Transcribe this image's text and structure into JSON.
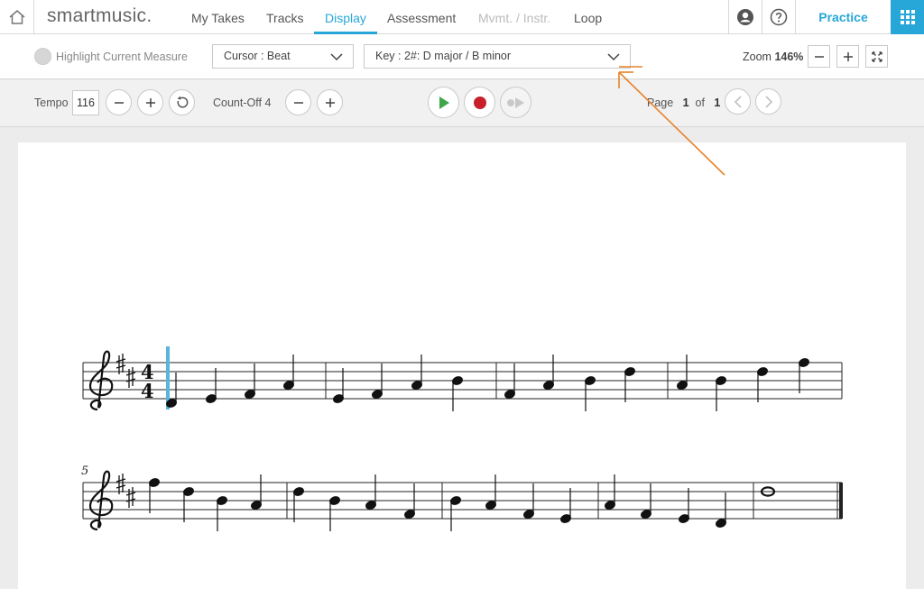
{
  "app": {
    "logo": "smartmusic.",
    "nav": [
      {
        "label": "My Takes",
        "state": "normal"
      },
      {
        "label": "Tracks",
        "state": "normal"
      },
      {
        "label": "Display",
        "state": "active"
      },
      {
        "label": "Assessment",
        "state": "normal"
      },
      {
        "label": "Mvmt. / Instr.",
        "state": "disabled"
      },
      {
        "label": "Loop",
        "state": "normal"
      }
    ],
    "practice_label": "Practice",
    "accent_color": "#27a7d8"
  },
  "display": {
    "highlight_label": "Highlight Current Measure",
    "cursor_select": "Cursor : Beat",
    "key_select": "Key : 2#: D major / B minor",
    "zoom_label": "Zoom",
    "zoom_value": "146%"
  },
  "playback": {
    "tempo_label": "Tempo",
    "tempo_value": "116",
    "countoff_label": "Count-Off",
    "countoff_value": "4",
    "page_label": "Page",
    "page_current": "1",
    "page_of": "of",
    "page_total": "1"
  },
  "score": {
    "time_signature": {
      "top": "4",
      "bottom": "4"
    },
    "key_sharps": 2,
    "second_system_measure_number": "5",
    "cursor_color": "#5ab4dc",
    "system1_notes": [
      "D4",
      "E4",
      "F#4",
      "A4",
      "E4",
      "F#4",
      "A4",
      "B4",
      "F#4",
      "A4",
      "B4",
      "D5",
      "A4",
      "B4",
      "D5",
      "F#5"
    ],
    "system2_notes": [
      "F#5",
      "D5",
      "B4",
      "A4",
      "D5",
      "B4",
      "A4",
      "F#4",
      "B4",
      "A4",
      "F#4",
      "E4",
      "A4",
      "F#4",
      "E4",
      "D4",
      "D5"
    ]
  },
  "annotation": {
    "color": "#e8822a"
  }
}
